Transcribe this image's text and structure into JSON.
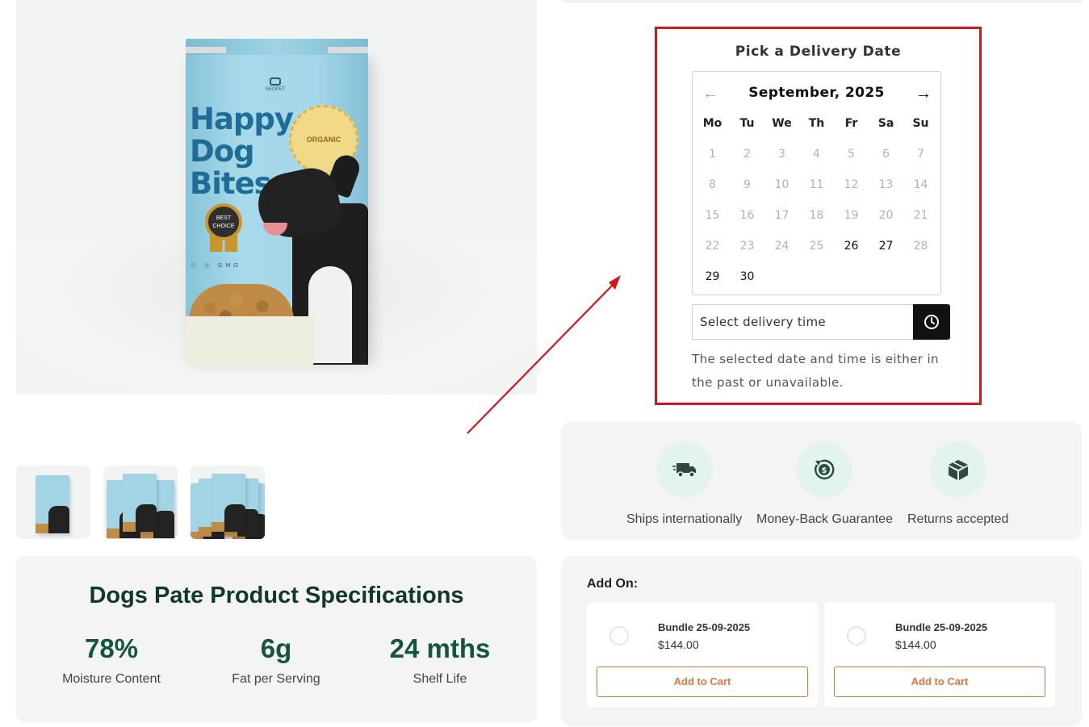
{
  "product_image": {
    "bag_brand": "GEOPET",
    "bag_title_lines": [
      "Happy",
      "Dog",
      "Bites"
    ],
    "organic_badge": "ORGANIC",
    "best_badge": "BEST CHOICE",
    "bag_badges": "ⓥ ⓐ GMO"
  },
  "thumbnails": [
    {
      "name": "thumbnail-single-bag"
    },
    {
      "name": "thumbnail-three-bags"
    },
    {
      "name": "thumbnail-five-bags"
    }
  ],
  "specs": {
    "title": "Dogs Pate Product Specifications",
    "items": [
      {
        "value": "78%",
        "label": "Moisture Content"
      },
      {
        "value": "6g",
        "label": "Fat per Serving"
      },
      {
        "value": "24 mths",
        "label": "Shelf Life"
      }
    ]
  },
  "delivery": {
    "title": "Pick a Delivery Date",
    "month": "September, 2025",
    "prev_icon": "←",
    "next_icon": "→",
    "weekdays": [
      "Mo",
      "Tu",
      "We",
      "Th",
      "Fr",
      "Sa",
      "Su"
    ],
    "days": [
      {
        "d": "1",
        "available": false
      },
      {
        "d": "2",
        "available": false
      },
      {
        "d": "3",
        "available": false
      },
      {
        "d": "4",
        "available": false
      },
      {
        "d": "5",
        "available": false
      },
      {
        "d": "6",
        "available": false
      },
      {
        "d": "7",
        "available": false
      },
      {
        "d": "8",
        "available": false
      },
      {
        "d": "9",
        "available": false
      },
      {
        "d": "10",
        "available": false
      },
      {
        "d": "11",
        "available": false
      },
      {
        "d": "12",
        "available": false
      },
      {
        "d": "13",
        "available": false
      },
      {
        "d": "14",
        "available": false
      },
      {
        "d": "15",
        "available": false
      },
      {
        "d": "16",
        "available": false
      },
      {
        "d": "17",
        "available": false
      },
      {
        "d": "18",
        "available": false
      },
      {
        "d": "19",
        "available": false
      },
      {
        "d": "20",
        "available": false
      },
      {
        "d": "21",
        "available": false
      },
      {
        "d": "22",
        "available": false
      },
      {
        "d": "23",
        "available": false
      },
      {
        "d": "24",
        "available": false
      },
      {
        "d": "25",
        "available": false
      },
      {
        "d": "26",
        "available": true
      },
      {
        "d": "27",
        "available": true
      },
      {
        "d": "28",
        "available": false
      },
      {
        "d": "29",
        "available": true
      },
      {
        "d": "30",
        "available": true
      }
    ],
    "time_placeholder": "Select delivery time",
    "time_icon": "clock-icon",
    "message": "The selected date and time is either in the past or unavailable.",
    "highlight_color": "#d3161c"
  },
  "features": [
    {
      "label": "Ships internationally",
      "icon": "truck-icon"
    },
    {
      "label": "Money-Back Guarantee",
      "icon": "money-back-icon"
    },
    {
      "label": "Returns accepted",
      "icon": "box-icon"
    }
  ],
  "addon": {
    "title": "Add On:",
    "cards": [
      {
        "name": "Bundle 25-09-2025",
        "price": "$144.00",
        "button": "Add to Cart"
      },
      {
        "name": "Bundle 25-09-2025",
        "price": "$144.00",
        "button": "Add to Cart"
      }
    ]
  },
  "colors": {
    "accent_green": "#15553f",
    "feature_circle": "#e3f4ef",
    "addon_button": "#e0763a"
  }
}
